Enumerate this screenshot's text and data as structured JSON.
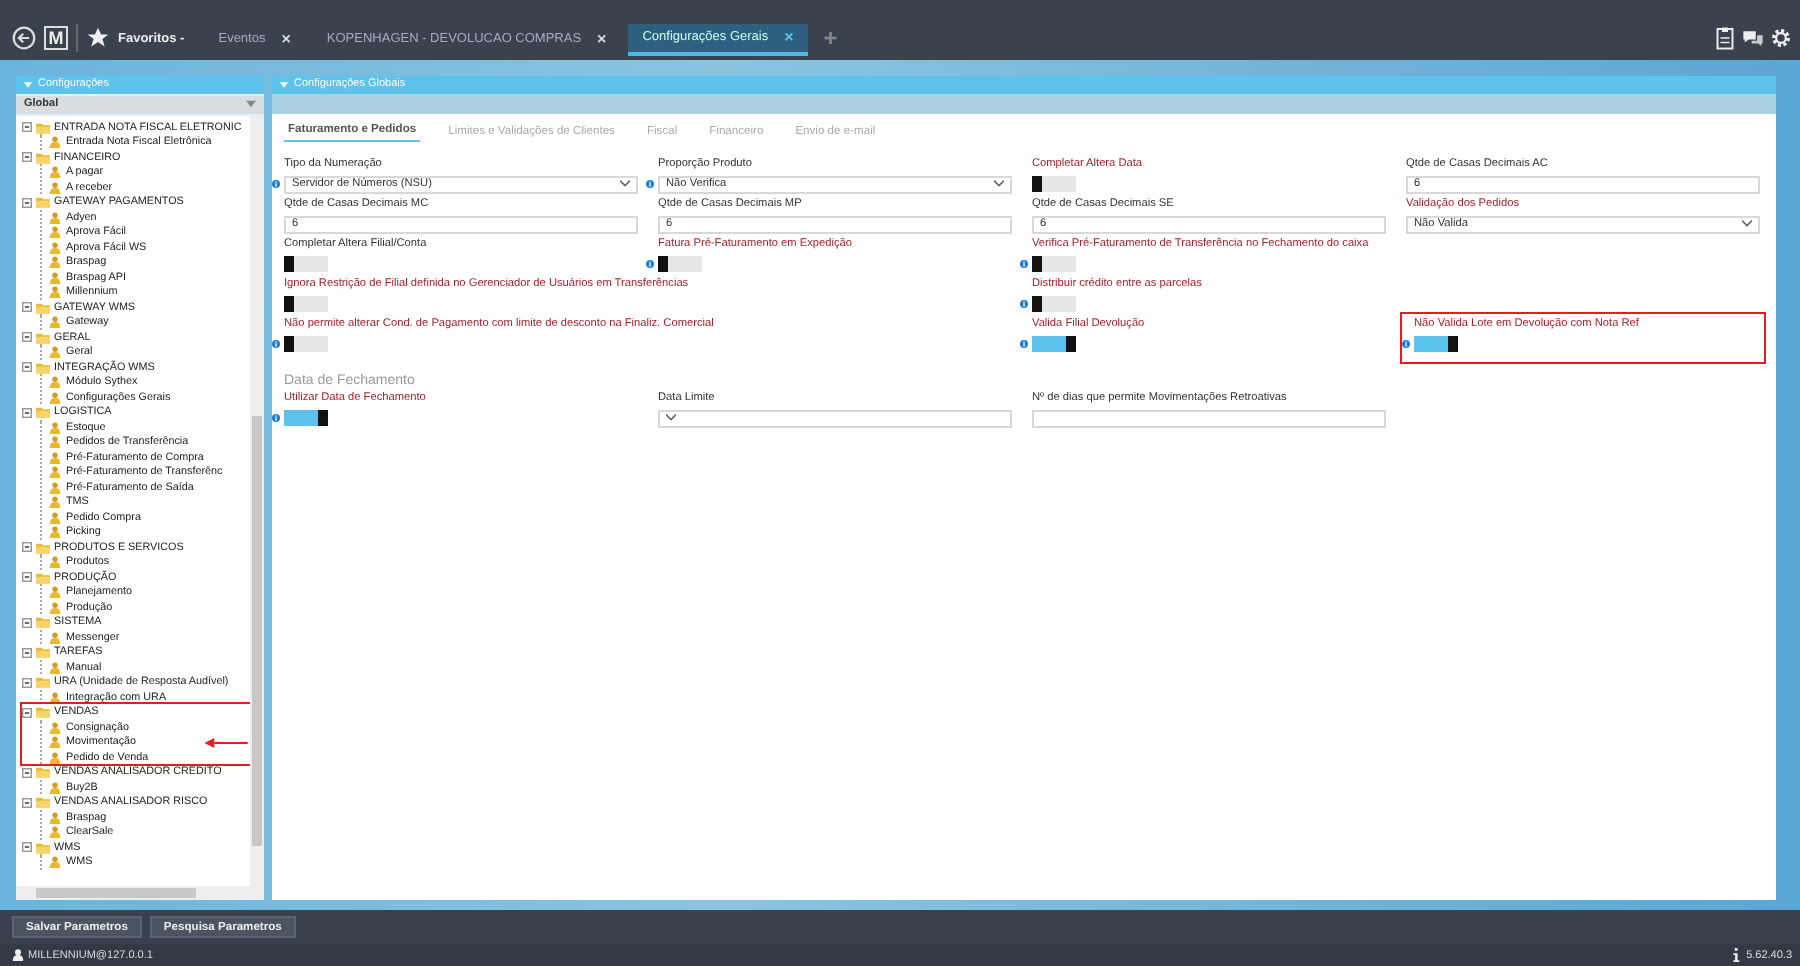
{
  "topbar": {
    "logo": "M",
    "favorites": "Favoritos -",
    "tabs": [
      {
        "label": "Eventos",
        "close": "×",
        "selected": false
      },
      {
        "label": "KOPENHAGEN - DEVOLUCAO COMPRAS",
        "close": "×",
        "selected": false
      },
      {
        "label": "Configurações Gerais",
        "close": "×",
        "selected": true
      }
    ],
    "add": "+"
  },
  "sidebar": {
    "title": "Configurações",
    "scope": "Global",
    "tree": [
      {
        "label": "ENTRADA NOTA FISCAL ELETRONIC",
        "expanded": true,
        "children": [
          {
            "label": "Entrada Nota Fiscal Eletrônica"
          }
        ]
      },
      {
        "label": "FINANCEIRO",
        "expanded": true,
        "children": [
          {
            "label": "A pagar"
          },
          {
            "label": "A receber"
          }
        ]
      },
      {
        "label": "GATEWAY PAGAMENTOS",
        "expanded": true,
        "children": [
          {
            "label": "Adyen"
          },
          {
            "label": "Aprova Fácil"
          },
          {
            "label": "Aprova Fácil WS"
          },
          {
            "label": "Braspag"
          },
          {
            "label": "Braspag API"
          },
          {
            "label": "Millennium"
          }
        ]
      },
      {
        "label": "GATEWAY WMS",
        "expanded": true,
        "children": [
          {
            "label": "Gateway"
          }
        ]
      },
      {
        "label": "GERAL",
        "expanded": true,
        "children": [
          {
            "label": "Geral"
          }
        ]
      },
      {
        "label": "INTEGRAÇÃO WMS",
        "expanded": true,
        "children": [
          {
            "label": "Módulo Sythex"
          },
          {
            "label": "Configurações Gerais"
          }
        ]
      },
      {
        "label": "LOGISTICA",
        "expanded": true,
        "children": [
          {
            "label": "Estoque"
          },
          {
            "label": "Pedidos de Transferência"
          },
          {
            "label": "Pré-Faturamento de Compra"
          },
          {
            "label": "Pré-Faturamento de Transferênc"
          },
          {
            "label": "Pré-Faturamento de Saída"
          },
          {
            "label": "TMS"
          },
          {
            "label": "Pedido Compra"
          },
          {
            "label": "Picking"
          }
        ]
      },
      {
        "label": "PRODUTOS E SERVICOS",
        "expanded": true,
        "children": [
          {
            "label": "Produtos"
          }
        ]
      },
      {
        "label": "PRODUÇÃO",
        "expanded": true,
        "children": [
          {
            "label": "Planejamento"
          },
          {
            "label": "Produção"
          }
        ]
      },
      {
        "label": "SISTEMA",
        "expanded": true,
        "children": [
          {
            "label": "Messenger"
          }
        ]
      },
      {
        "label": "TAREFAS",
        "expanded": true,
        "children": [
          {
            "label": "Manual"
          }
        ]
      },
      {
        "label": "URA (Unidade de Resposta Audível)",
        "expanded": true,
        "children": [
          {
            "label": "Integração com URA"
          }
        ]
      },
      {
        "label": "VENDAS",
        "expanded": true,
        "highlighted": true,
        "children": [
          {
            "label": "Consignação"
          },
          {
            "label": "Movimentação",
            "pointer": true
          },
          {
            "label": "Pedido de Venda"
          }
        ]
      },
      {
        "label": "VENDAS ANALISADOR CREDITO",
        "expanded": true,
        "children": [
          {
            "label": "Buy2B"
          }
        ]
      },
      {
        "label": "VENDAS ANALISADOR RISCO",
        "expanded": true,
        "children": [
          {
            "label": "Braspag"
          },
          {
            "label": "ClearSale"
          }
        ]
      },
      {
        "label": "WMS",
        "expanded": true,
        "children": [
          {
            "label": "WMS"
          }
        ]
      }
    ]
  },
  "main": {
    "title": "Configurações Globais",
    "tabs": [
      {
        "label": "Faturamento e Pedidos",
        "selected": true
      },
      {
        "label": "Limites e Validações de Clientes",
        "selected": false
      },
      {
        "label": "Fiscal",
        "selected": false
      },
      {
        "label": "Financeiro",
        "selected": false
      },
      {
        "label": "Envio de e-mail",
        "selected": false
      }
    ],
    "rows": [
      [
        {
          "kind": "select",
          "label": "Tipo da Numeração",
          "required": false,
          "info": true,
          "value": "Servidor de Números (NSU)"
        },
        {
          "kind": "select",
          "label": "Proporção Produto",
          "required": false,
          "info": true,
          "value": "Não Verifica"
        },
        {
          "kind": "toggle",
          "label": "Completar Altera Data",
          "required": true,
          "info": false,
          "on": false
        },
        {
          "kind": "input",
          "label": "Qtde de Casas Decimais AC",
          "required": false,
          "info": false,
          "value": "6"
        }
      ],
      [
        {
          "kind": "input",
          "label": "Qtde de Casas Decimais MC",
          "required": false,
          "info": false,
          "value": "6"
        },
        {
          "kind": "input",
          "label": "Qtde de Casas Decimais MP",
          "required": false,
          "info": false,
          "value": "6"
        },
        {
          "kind": "input",
          "label": "Qtde de Casas Decimais SE",
          "required": false,
          "info": false,
          "value": "6"
        },
        {
          "kind": "select",
          "label": "Validação dos Pedidos",
          "required": true,
          "info": false,
          "value": "Não Valida"
        }
      ],
      [
        {
          "kind": "toggle",
          "label": "Completar Altera Filial/Conta",
          "required": false,
          "info": false,
          "on": false
        },
        {
          "kind": "toggle",
          "label": "Fatura Pré-Faturamento em Expedição",
          "required": true,
          "info": true,
          "on": false
        },
        {
          "kind": "toggle",
          "label": "Verifica Pré-Faturamento de Transferência no Fechamento do caixa",
          "required": true,
          "info": true,
          "on": false
        }
      ],
      [
        {
          "kind": "toggle",
          "label": "Ignora Restrição de Filial definida no Gerenciador de Usuários em Transferências",
          "required": true,
          "info": false,
          "on": false
        },
        "",
        {
          "kind": "toggle",
          "label": "Distribuir crédito entre as parcelas",
          "required": true,
          "info": true,
          "on": false
        }
      ],
      [
        {
          "kind": "toggle",
          "label": "Não permite alterar Cond. de Pagamento com limite de desconto na Finaliz. Comercial",
          "required": true,
          "info": true,
          "on": false
        },
        "",
        {
          "kind": "toggle",
          "label": "Valida Filial Devolução",
          "required": true,
          "info": true,
          "on": true
        },
        {
          "kind": "toggle",
          "label": "Não Valida Lote em Devolução com Nota Ref",
          "required": true,
          "info": true,
          "on": true,
          "highlighted": true
        }
      ]
    ],
    "section": {
      "title": "Data de Fechamento",
      "rows": [
        [
          {
            "kind": "toggle",
            "label": "Utilizar Data de Fechamento",
            "required": true,
            "info": true,
            "on": true
          },
          {
            "kind": "select",
            "label": "Data Limite",
            "required": false,
            "info": false
          },
          {
            "kind": "input",
            "label": "Nº de dias que permite Movimentações Retroativas",
            "required": false,
            "info": false
          }
        ]
      ]
    }
  },
  "buttons": [
    "Salvar Parametros",
    "Pesquisa Parametros"
  ],
  "status_bar": {
    "user": "MILLENNIUM@127.0.0.1",
    "version": "5.62.40.3"
  }
}
